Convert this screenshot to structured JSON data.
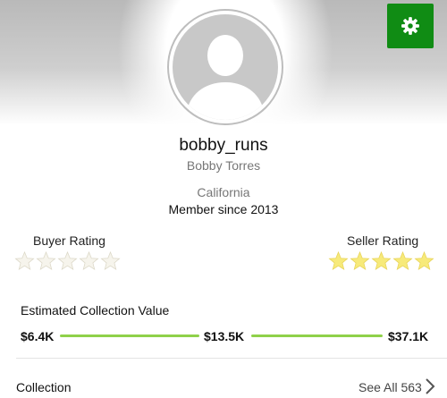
{
  "profile": {
    "username": "bobby_runs",
    "full_name": "Bobby Torres",
    "location": "California",
    "member_since": "Member since 2013"
  },
  "settings": {
    "icon": "gear-icon",
    "color": "#108c14"
  },
  "ratings": {
    "buyer": {
      "label": "Buyer Rating",
      "stars_filled": 0,
      "stars_total": 5
    },
    "seller": {
      "label": "Seller Rating",
      "stars_filled": 5,
      "stars_total": 5
    },
    "filled_color": "#f7ea7a",
    "empty_color": "#f6f4ec"
  },
  "collection_value": {
    "title": "Estimated Collection Value",
    "low": "$6.4K",
    "mid": "$13.5K",
    "high": "$37.1K",
    "bar_color": "#8fd14a"
  },
  "collection": {
    "label": "Collection",
    "see_all": "See All 563"
  }
}
